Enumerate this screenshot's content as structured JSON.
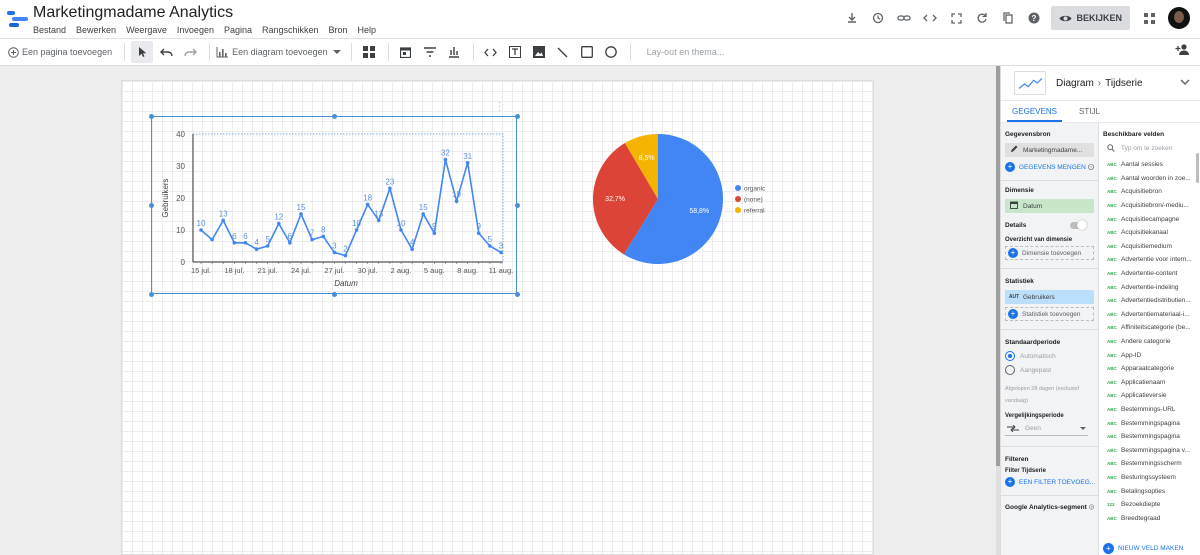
{
  "app": {
    "title": "Marketingmadame Analytics",
    "menu": [
      "Bestand",
      "Bewerken",
      "Weergave",
      "Invoegen",
      "Pagina",
      "Rangschikken",
      "Bron",
      "Help"
    ],
    "view_button": "BEKIJKEN",
    "header_icons": [
      "download-icon",
      "history-icon",
      "link-icon",
      "embed-code-icon",
      "fullscreen-icon",
      "refresh-icon",
      "copy-icon",
      "help-icon"
    ]
  },
  "toolbar": {
    "add_page": "Een pagina toevoegen",
    "add_chart": "Een diagram toevoegen",
    "layout_theme": "Lay-out en thema..."
  },
  "panel": {
    "crumb_type": "Diagram",
    "crumb_sub": "Tijdserie",
    "tabs": [
      "GEGEVENS",
      "STIJL"
    ],
    "data_source_label": "Gegevensbron",
    "data_source_value": "Marketingmadame...",
    "blend_label": "GEGEVENS MENGEN",
    "dimension_label": "Dimensie",
    "dimension_value": "Datum",
    "details_label": "Details",
    "drilldown_label": "Overzicht van dimensie",
    "add_dimension": "Dimensie toevoegen",
    "metrics_label": "Statistiek",
    "metric_badge": "AUT",
    "metric_value": "Gebruikers",
    "add_metric": "Statistiek toevoegen",
    "default_range_label": "Standaardperiode",
    "range_auto": "Automatisch",
    "range_custom": "Aangepast",
    "range_note": "Afgelopen 28 dagen (exclusief vandaag)",
    "compare_label": "Vergelijkingsperiode",
    "compare_value": "Geen",
    "filter_label": "Filteren",
    "filter_sub": "Filter Tijdserie",
    "add_filter": "EEN FILTER TOEVOEG...",
    "segment_label": "Google Analytics-segment",
    "fields_label": "Beschikbare velden",
    "fields_search": "Typ om te zoeken",
    "fields": [
      "Aantal sessies",
      "Aantal woorden in zoe...",
      "Acquisitiebron",
      "Acquisitiebron/-mediu...",
      "Acquisitiecampagne",
      "Acquisitiekanaal",
      "Acquisitiemedium",
      "Advertentie voor intern...",
      "Advertentie-content",
      "Advertentie-indeling",
      "Advertentiedistributien...",
      "Advertentiemateriaal-i...",
      "Affiniteitscategorie (be...",
      "Andere categorie",
      "App-ID",
      "Apparaatcategorie",
      "Applicatienaam",
      "Applicatieversie",
      "Bestemmings-URL",
      "Bestemmingspagina",
      "Bestemmingspagina",
      "Bestemmingspagina v...",
      "Bestemmingsscherm",
      "Besturingssysteem",
      "Betalingsopties",
      "Bezoekdiepte",
      "Breedtegraad"
    ],
    "field_badges": [
      "ABC",
      "ABC",
      "ABC",
      "ABC",
      "ABC",
      "ABC",
      "ABC",
      "ABC",
      "ABC",
      "ABC",
      "ABC",
      "ABC",
      "ABC",
      "ABC",
      "ABC",
      "ABC",
      "ABC",
      "ABC",
      "ABC",
      "ABC",
      "ABC",
      "ABC",
      "ABC",
      "ABC",
      "ABC",
      "123",
      "ABC"
    ],
    "new_field": "NIEUW VELD MAKEN"
  },
  "chart_data": [
    {
      "type": "line",
      "xlabel": "Datum",
      "ylabel": "Gebruikers",
      "ylim": [
        0,
        40
      ],
      "yticks": [
        0,
        10,
        20,
        30,
        40
      ],
      "xtick_labels": [
        "15 jul.",
        "18 jul.",
        "21 jul.",
        "24 jul.",
        "27 jul.",
        "30 jul.",
        "2 aug.",
        "5 aug.",
        "8 aug.",
        "11 aug."
      ],
      "x": [
        "15 jul.",
        "16 jul.",
        "17 jul.",
        "18 jul.",
        "19 jul.",
        "20 jul.",
        "21 jul.",
        "22 jul.",
        "23 jul.",
        "24 jul.",
        "25 jul.",
        "26 jul.",
        "27 jul.",
        "28 jul.",
        "29 jul.",
        "30 jul.",
        "31 jul.",
        "1 aug.",
        "2 aug.",
        "3 aug.",
        "4 aug.",
        "5 aug.",
        "6 aug.",
        "7 aug.",
        "8 aug.",
        "9 aug.",
        "10 aug.",
        "11 aug."
      ],
      "series": [
        {
          "name": "Gebruikers",
          "values": [
            10,
            7,
            13,
            6,
            6,
            4,
            5,
            12,
            6,
            15,
            7,
            8,
            3,
            2,
            10,
            18,
            13,
            23,
            10,
            4,
            15,
            9,
            32,
            19,
            31,
            9,
            5,
            3
          ]
        }
      ],
      "point_labels": [
        "10",
        "",
        "13",
        "6",
        "6",
        "4",
        "5",
        "12",
        "6",
        "15",
        "7",
        "8",
        "3",
        "2",
        "10",
        "18",
        "13",
        "23",
        "10",
        "4",
        "15",
        "9",
        "32",
        "19",
        "31",
        "9",
        "5",
        "3"
      ],
      "color": "#4285f4",
      "grid": false
    },
    {
      "type": "pie",
      "categories": [
        "organic",
        "(none)",
        "referral"
      ],
      "values": [
        58.8,
        32.7,
        8.5
      ],
      "value_labels": [
        "58,8%",
        "32,7%",
        "8,5%"
      ],
      "colors": [
        "#4285f4",
        "#db4437",
        "#f4b400"
      ],
      "legend": "right"
    }
  ]
}
